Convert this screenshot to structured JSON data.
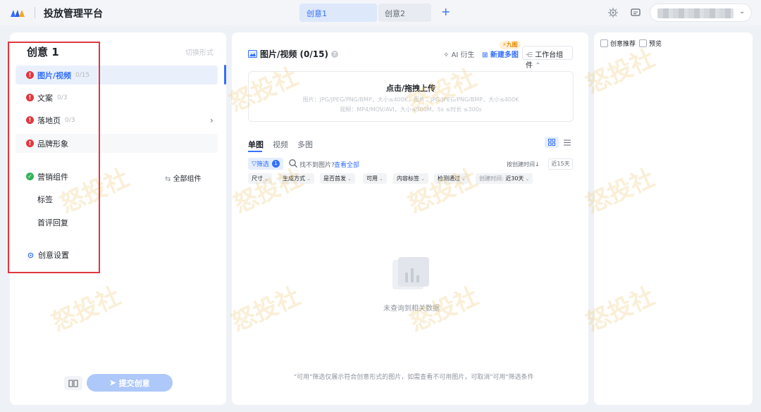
{
  "header": {
    "app_title": "投放管理平台",
    "tabs": [
      {
        "label": "创意1",
        "active": true
      },
      {
        "label": "创意2",
        "active": false
      }
    ],
    "add_tab": "+"
  },
  "left": {
    "title": "创意 1",
    "title_action": "切换形式",
    "items": [
      {
        "label": "图片/视频",
        "count": "0/15",
        "status": "error",
        "active": true
      },
      {
        "label": "文案",
        "count": "0/3",
        "status": "error"
      },
      {
        "label": "落地页",
        "count": "0/3",
        "status": "error"
      },
      {
        "label": "品牌形象",
        "count": "",
        "status": "error"
      },
      {
        "label": "营销组件",
        "count": "",
        "status": "ok"
      }
    ],
    "all_components": "全部组件",
    "sub_items": [
      "标签",
      "首评回复"
    ],
    "settings": "创意设置",
    "submit": "提交创意"
  },
  "main": {
    "title": "图片/视频 (0/15)",
    "ai_derive": "AI 衍生",
    "new_multi": "新建多图",
    "badge": "⚡九图",
    "workbench": "工作台组件",
    "upload": {
      "title": "点击/拖拽上传",
      "hint1": "图片：JPG/JPEG/PNG/BMP，大小≤400K，图片：JPG/JPEG/PNG/BMP，大小≤400K",
      "hint2": "视频：MP4/MOV/AVI，大小≤500M，5s ≤时长 ≤300s"
    },
    "tabs": [
      "单图",
      "视频",
      "多图"
    ],
    "filter_label": "筛选",
    "filter_count": "1",
    "not_found": "找不到图片?",
    "see_all": "查看全部",
    "sort": "按创建时间",
    "range": "近15天",
    "chips": [
      {
        "label": "尺寸"
      },
      {
        "label": "生成方式"
      },
      {
        "label": "是否首发"
      },
      {
        "label": "可用"
      },
      {
        "label": "内容标签"
      },
      {
        "label": "检测通过"
      },
      {
        "label": "创建时间:",
        "value": "近30天"
      }
    ],
    "empty_text": "未查询到相关数据",
    "footnote": "\"可用\"筛选仅展示符合创意形式的图片，如需查看不可用图片，可取消\"可用\"筛选条件"
  },
  "right": {
    "tabs": [
      "创意推荐",
      "预览"
    ]
  },
  "watermark": "怒投社",
  "colors": {
    "accent": "#3370ff",
    "error": "#e0383e",
    "success": "#34b35a",
    "highlight": "#e0383e"
  }
}
